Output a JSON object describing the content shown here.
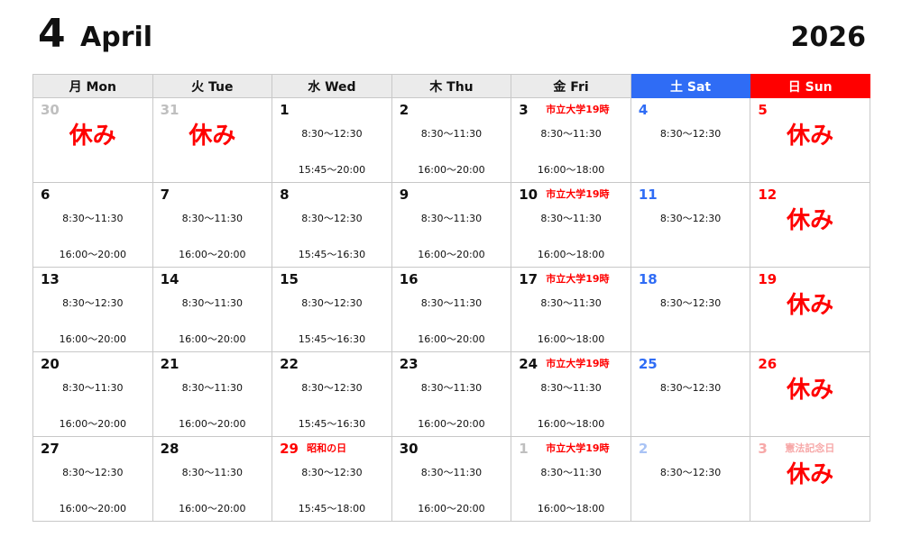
{
  "header": {
    "month_number": "4",
    "month_name": "April",
    "year": "2026"
  },
  "weekdays": [
    "月 Mon",
    "火 Tue",
    "水 Wed",
    "木 Thu",
    "金 Fri",
    "土 Sat",
    "日 Sun"
  ],
  "weeks": [
    [
      {
        "day": "30",
        "muted": true,
        "closed": "休み"
      },
      {
        "day": "31",
        "muted": true,
        "closed": "休み"
      },
      {
        "day": "1",
        "time1": "8:30～12:30",
        "time2": "15:45～20:00"
      },
      {
        "day": "2",
        "time1": "8:30～11:30",
        "time2": "16:00～20:00"
      },
      {
        "day": "3",
        "note": "市立大学19時",
        "time1": "8:30～11:30",
        "time2": "16:00～18:00"
      },
      {
        "day": "4",
        "time1": "8:30～12:30"
      },
      {
        "day": "5",
        "closed": "休み"
      }
    ],
    [
      {
        "day": "6",
        "time1": "8:30～11:30",
        "time2": "16:00～20:00"
      },
      {
        "day": "7",
        "time1": "8:30～11:30",
        "time2": "16:00～20:00"
      },
      {
        "day": "8",
        "time1": "8:30～12:30",
        "time2": "15:45～16:30"
      },
      {
        "day": "9",
        "time1": "8:30～11:30",
        "time2": "16:00～20:00"
      },
      {
        "day": "10",
        "note": "市立大学19時",
        "time1": "8:30～11:30",
        "time2": "16:00～18:00"
      },
      {
        "day": "11",
        "time1": "8:30～12:30"
      },
      {
        "day": "12",
        "closed": "休み"
      }
    ],
    [
      {
        "day": "13",
        "time1": "8:30～12:30",
        "time2": "16:00～20:00"
      },
      {
        "day": "14",
        "time1": "8:30～11:30",
        "time2": "16:00～20:00"
      },
      {
        "day": "15",
        "time1": "8:30～12:30",
        "time2": "15:45～16:30"
      },
      {
        "day": "16",
        "time1": "8:30～11:30",
        "time2": "16:00～20:00"
      },
      {
        "day": "17",
        "note": "市立大学19時",
        "time1": "8:30～11:30",
        "time2": "16:00～18:00"
      },
      {
        "day": "18",
        "time1": "8:30～12:30"
      },
      {
        "day": "19",
        "closed": "休み"
      }
    ],
    [
      {
        "day": "20",
        "time1": "8:30～11:30",
        "time2": "16:00～20:00"
      },
      {
        "day": "21",
        "time1": "8:30～11:30",
        "time2": "16:00～20:00"
      },
      {
        "day": "22",
        "time1": "8:30～12:30",
        "time2": "15:45～16:30"
      },
      {
        "day": "23",
        "time1": "8:30～11:30",
        "time2": "16:00～20:00"
      },
      {
        "day": "24",
        "note": "市立大学19時",
        "time1": "8:30～11:30",
        "time2": "16:00～18:00"
      },
      {
        "day": "25",
        "time1": "8:30～12:30"
      },
      {
        "day": "26",
        "closed": "休み"
      }
    ],
    [
      {
        "day": "27",
        "time1": "8:30～12:30",
        "time2": "16:00～20:00"
      },
      {
        "day": "28",
        "time1": "8:30～11:30",
        "time2": "16:00～20:00"
      },
      {
        "day": "29",
        "holiday": true,
        "note": "昭和の日",
        "time1": "8:30～12:30",
        "time2": "15:45～18:00"
      },
      {
        "day": "30",
        "time1": "8:30～11:30",
        "time2": "16:00～20:00"
      },
      {
        "day": "1",
        "muted": true,
        "note": "市立大学19時",
        "time1": "8:30～11:30",
        "time2": "16:00～18:00"
      },
      {
        "day": "2",
        "muted": true,
        "time1": "8:30～12:30"
      },
      {
        "day": "3",
        "muted": true,
        "note": "憲法記念日",
        "closed": "休み"
      }
    ]
  ]
}
